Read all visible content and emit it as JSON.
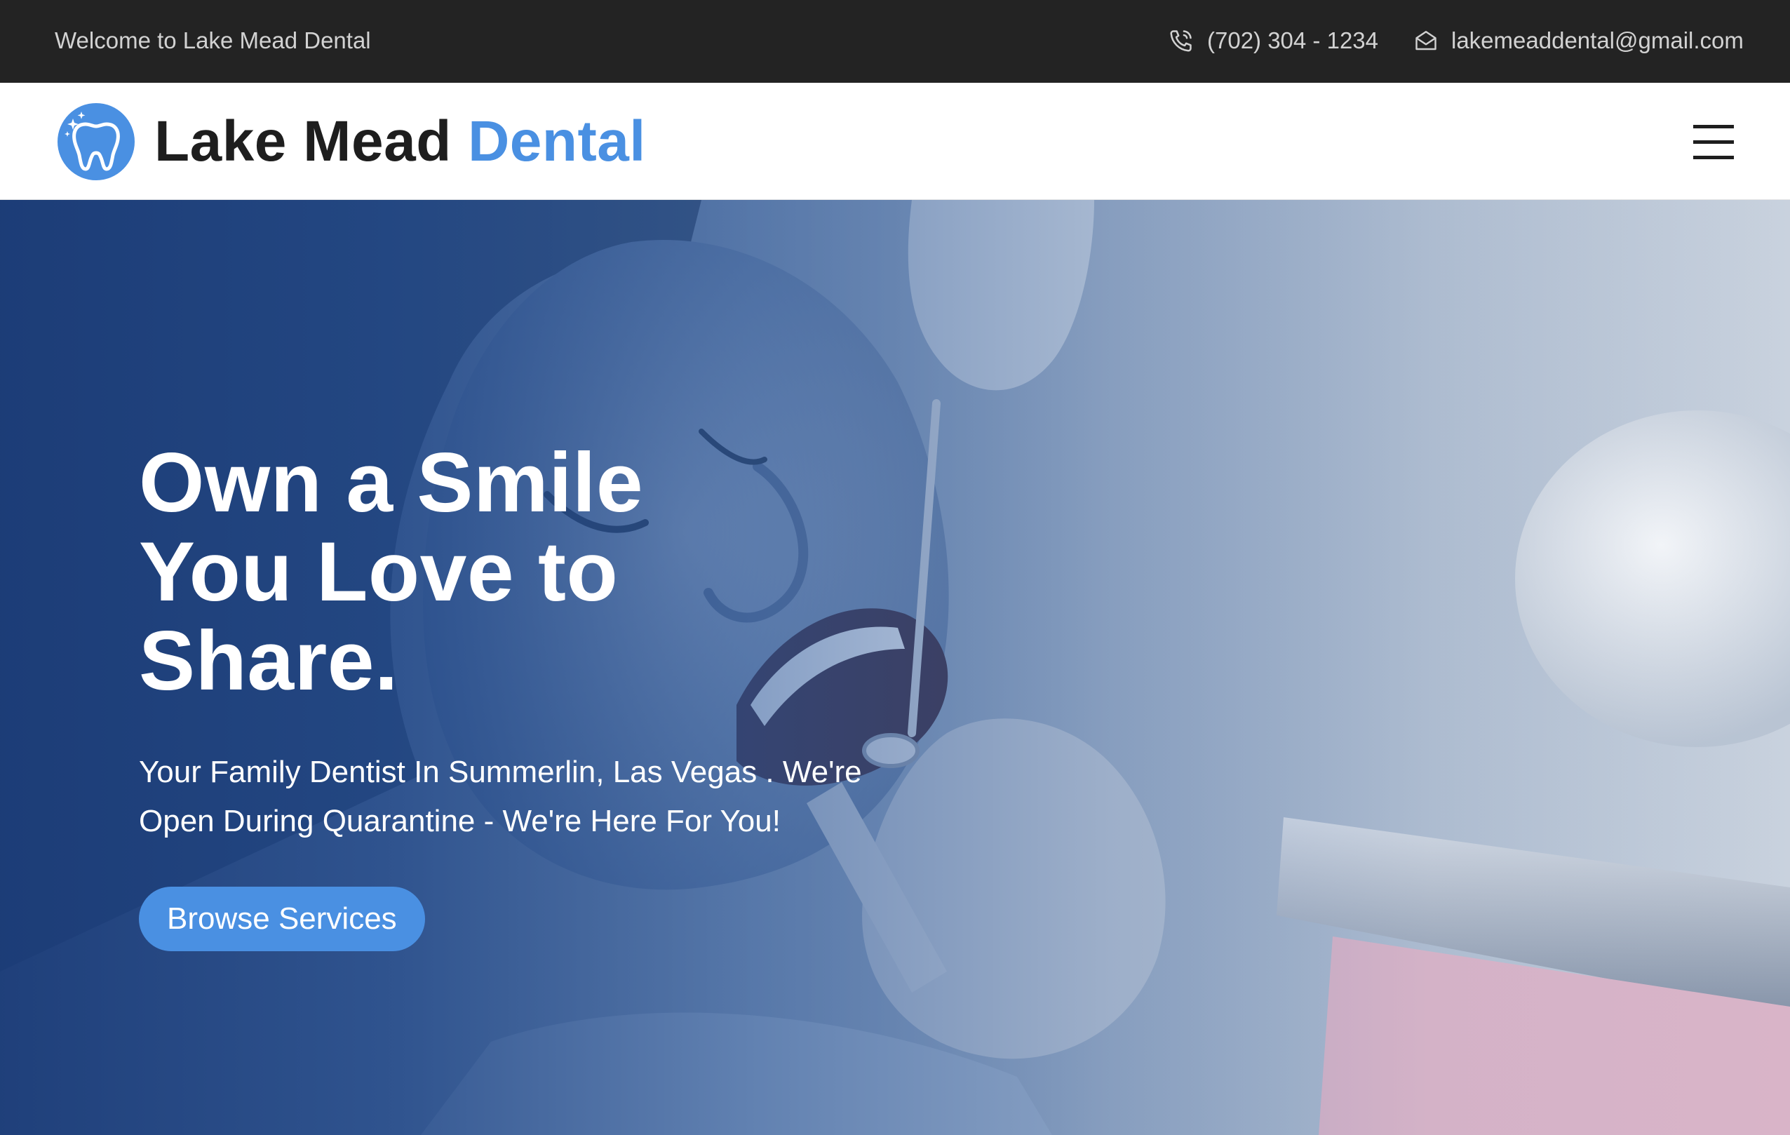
{
  "topbar": {
    "welcome": "Welcome to Lake Mead Dental",
    "phone": "(702) 304 - 1234",
    "phone_icon": "phone-icon",
    "email": "lakemeaddental@gmail.com",
    "email_icon": "envelope-icon"
  },
  "header": {
    "logo_icon": "tooth-sparkle-icon",
    "brand_primary": "Lake Mead",
    "brand_accent": "Dental",
    "menu_icon": "hamburger-menu-icon"
  },
  "hero": {
    "title": "Own a Smile You Love to Share.",
    "subtitle": "Your Family Dentist In Summerlin, Las Vegas . We're Open During Quarantine - We're Here For You!",
    "cta_label": "Browse Services",
    "image": "patient-at-dentist-photo"
  },
  "colors": {
    "accent": "#4a90e2",
    "topbar_bg": "#232323",
    "overlay": "#1f468c"
  }
}
